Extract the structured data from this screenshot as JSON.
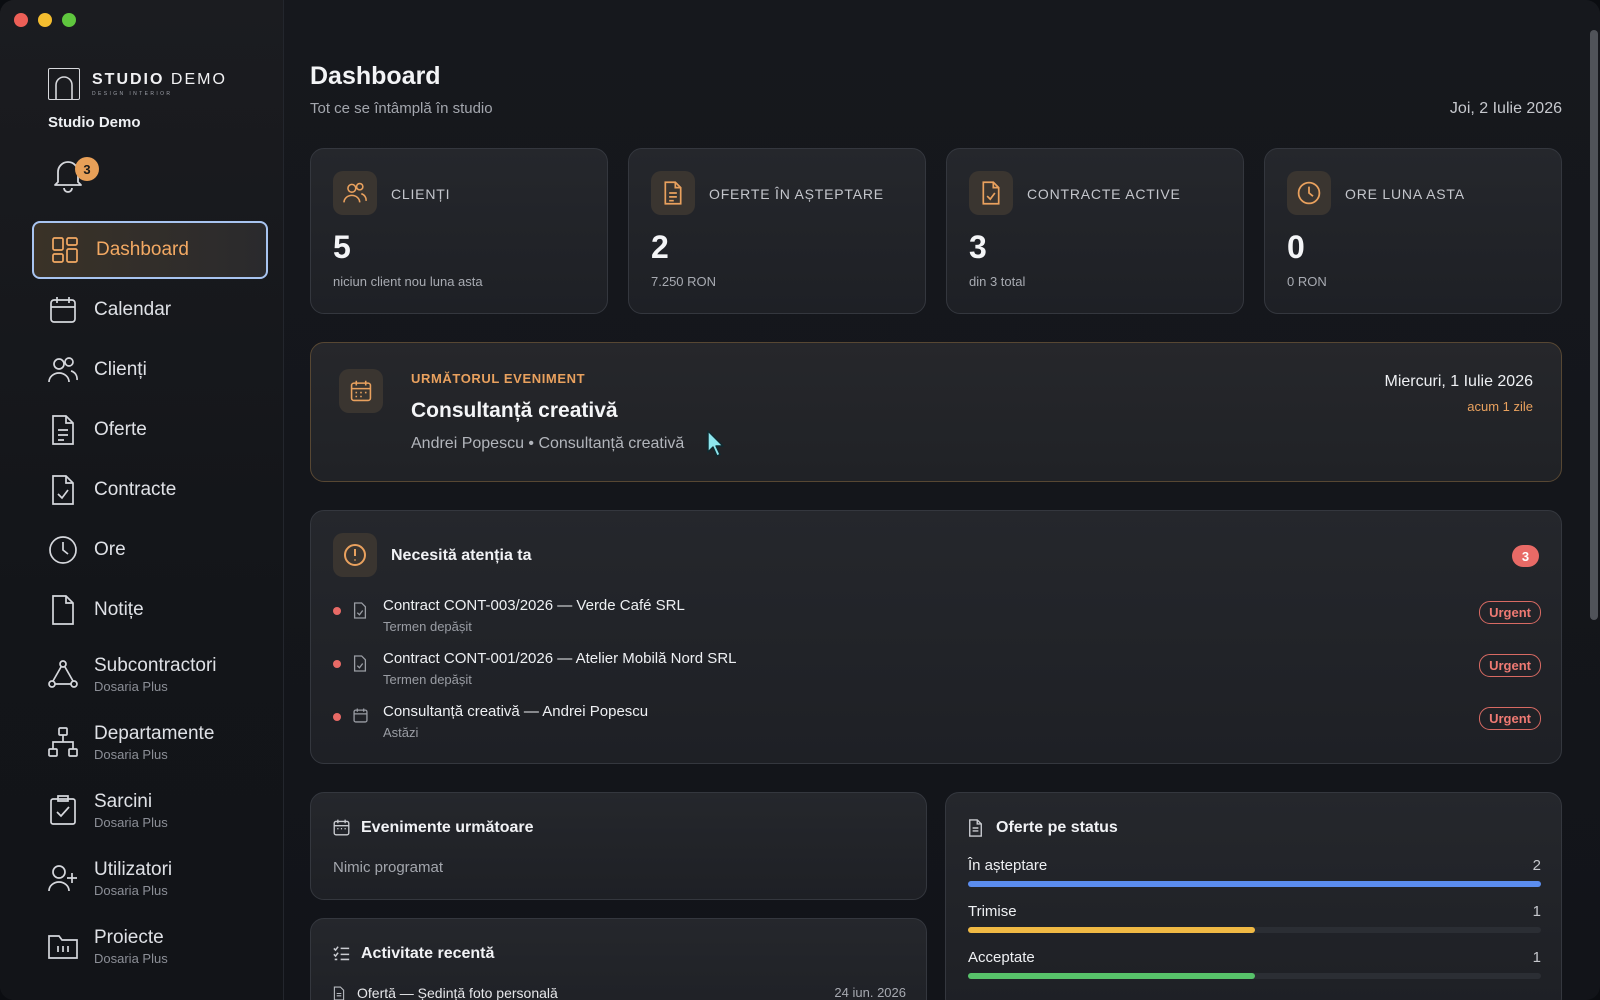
{
  "window": {
    "traffic_lights": [
      "close",
      "minimize",
      "maximize"
    ]
  },
  "brand": {
    "name_bold": "STUDIO",
    "name_light": "DEMO",
    "tagline": "DESIGN INTERIOR",
    "studio_name": "Studio Demo"
  },
  "notifications": {
    "count": "3",
    "icon": "bell-icon"
  },
  "sidebar": {
    "items": [
      {
        "label": "Dashboard",
        "icon": "dashboard-grid-icon",
        "active": true
      },
      {
        "label": "Calendar",
        "icon": "calendar-icon"
      },
      {
        "label": "Clienți",
        "icon": "users-icon"
      },
      {
        "label": "Oferte",
        "icon": "document-icon"
      },
      {
        "label": "Contracte",
        "icon": "contract-check-icon"
      },
      {
        "label": "Ore",
        "icon": "clock-icon"
      },
      {
        "label": "Notițe",
        "icon": "note-icon"
      },
      {
        "label": "Subcontractori",
        "sub": "Dosaria Plus",
        "icon": "network-icon"
      },
      {
        "label": "Departamente",
        "sub": "Dosaria Plus",
        "icon": "org-chart-icon"
      },
      {
        "label": "Sarcini",
        "sub": "Dosaria Plus",
        "icon": "task-check-icon"
      },
      {
        "label": "Utilizatori",
        "sub": "Dosaria Plus",
        "icon": "add-user-icon"
      },
      {
        "label": "Proiecte",
        "sub": "Dosaria Plus",
        "icon": "folder-icon"
      }
    ]
  },
  "header": {
    "title": "Dashboard",
    "subtitle": "Tot ce se întâmplă în studio",
    "date": "Joi, 2 Iulie 2026"
  },
  "stats": [
    {
      "title": "CLIENȚI",
      "value": "5",
      "note": "niciun client nou luna asta",
      "icon": "users-icon"
    },
    {
      "title": "OFERTE ÎN AȘTEPTARE",
      "value": "2",
      "note": "7.250 RON",
      "icon": "document-icon"
    },
    {
      "title": "CONTRACTE ACTIVE",
      "value": "3",
      "note": "din 3 total",
      "icon": "contract-check-icon"
    },
    {
      "title": "ORE LUNA ASTA",
      "value": "0",
      "note": "0 RON",
      "icon": "clock-icon"
    }
  ],
  "next_event": {
    "kicker": "URMĂTORUL EVENIMENT",
    "title": "Consultanță creativă",
    "meta": "Andrei Popescu • Consultanță creativă",
    "date": "Miercuri, 1 Iulie 2026",
    "ago": "acum 1 zile"
  },
  "attention": {
    "title": "Necesită atenția ta",
    "count": "3",
    "items": [
      {
        "title": "Contract CONT-003/2026 — Verde Café SRL",
        "sub": "Termen depășit",
        "badge": "Urgent",
        "icon": "contract-icon"
      },
      {
        "title": "Contract CONT-001/2026 — Atelier Mobilă Nord SRL",
        "sub": "Termen depășit",
        "badge": "Urgent",
        "icon": "contract-icon"
      },
      {
        "title": "Consultanță creativă — Andrei Popescu",
        "sub": "Astăzi",
        "badge": "Urgent",
        "icon": "calendar-icon"
      }
    ]
  },
  "upcoming": {
    "title": "Evenimente următoare",
    "empty": "Nimic programat"
  },
  "activity": {
    "title": "Activitate recentă",
    "items": [
      {
        "title": "Ofertă — Ședință foto personală",
        "date": "24 iun. 2026"
      }
    ]
  },
  "offers": {
    "title": "Oferte pe status",
    "rows": [
      {
        "label": "În așteptare",
        "value": "2",
        "color": "#5b8def",
        "fraction": 1.0
      },
      {
        "label": "Trimise",
        "value": "1",
        "color": "#f0b944",
        "fraction": 0.5
      },
      {
        "label": "Acceptate",
        "value": "1",
        "color": "#57c26a",
        "fraction": 0.5
      }
    ]
  },
  "colors": {
    "accent": "#e9a15e",
    "urgent": "#e86a66",
    "active_border": "#a8c4f0"
  }
}
